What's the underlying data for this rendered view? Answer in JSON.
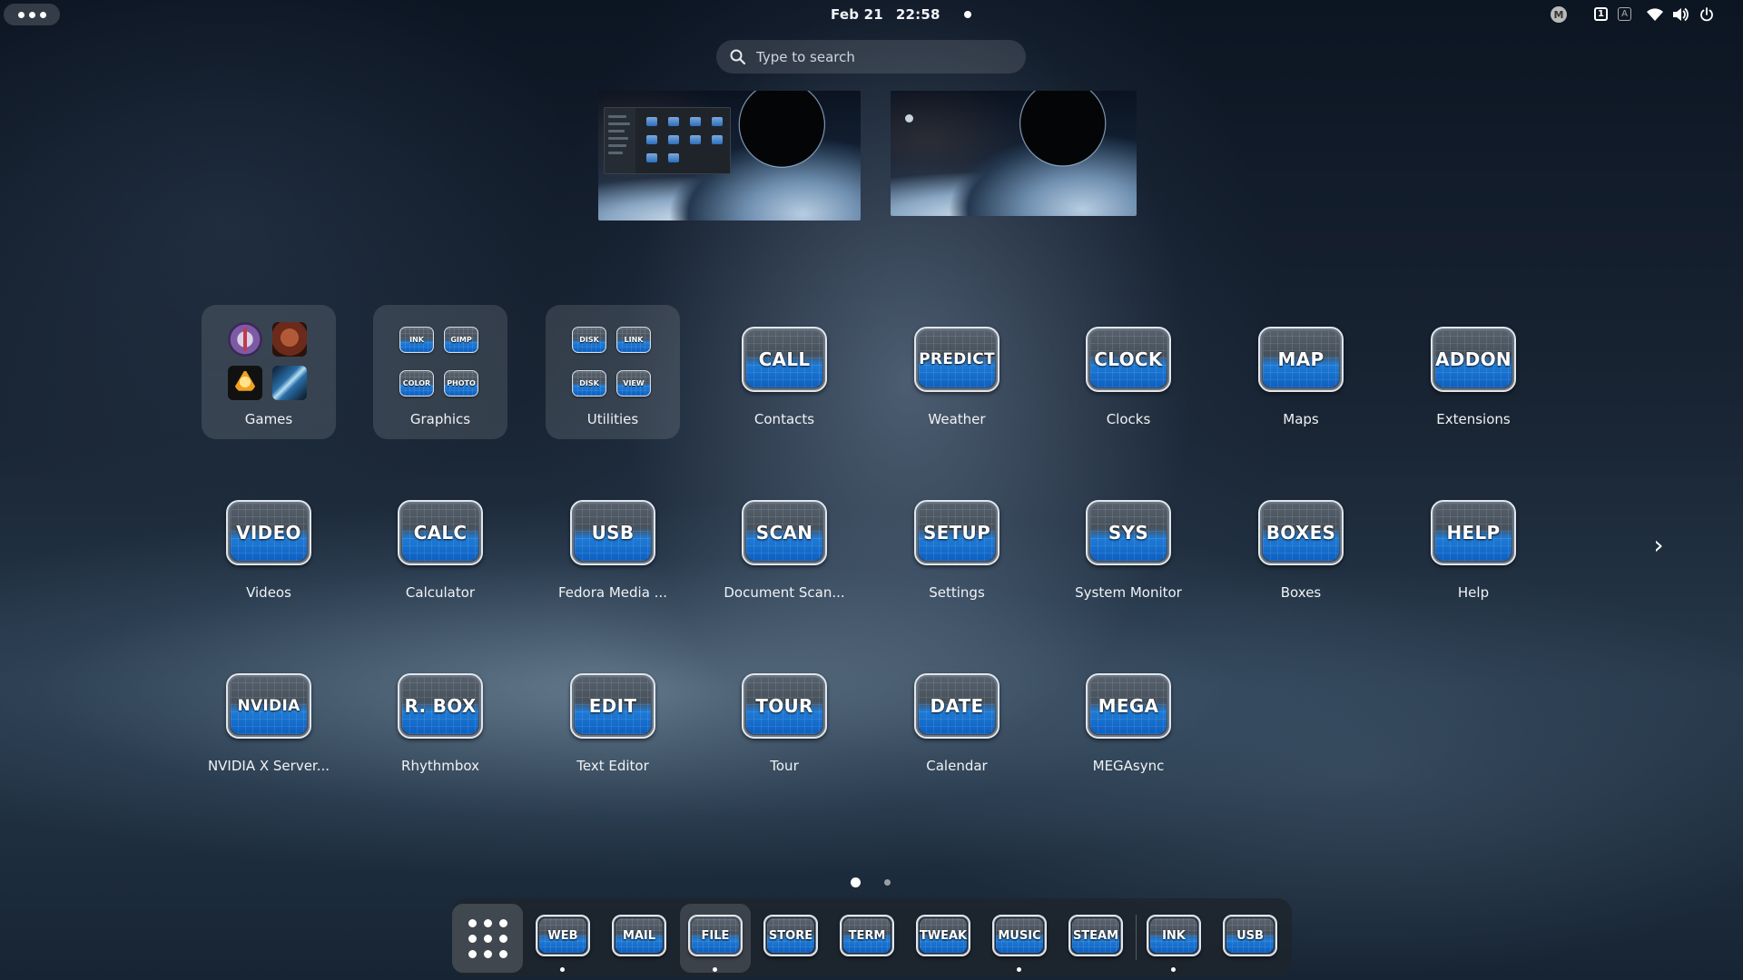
{
  "topbar": {
    "date": "Feb 21",
    "time": "22:58",
    "tray": {
      "mega_label": "M",
      "workspace_1": "1",
      "workspace_2": "A",
      "icons": [
        "mega-icon",
        "workspace-indicator-icon",
        "keyboard-layout-icon",
        "wifi-icon",
        "volume-icon",
        "power-icon"
      ]
    }
  },
  "search": {
    "placeholder": "Type to search"
  },
  "app_grid": {
    "folders": [
      {
        "label": "Games",
        "items": []
      },
      {
        "label": "Graphics",
        "items": [
          "INK",
          "GIMP",
          "COLOR",
          "PHOTO"
        ]
      },
      {
        "label": "Utilities",
        "items": [
          "DISK",
          "LINK",
          "DISK",
          "VIEW"
        ]
      }
    ],
    "apps": [
      {
        "label": "Contacts",
        "icon_text": "CALL"
      },
      {
        "label": "Weather",
        "icon_text": "PREDICT"
      },
      {
        "label": "Clocks",
        "icon_text": "CLOCK"
      },
      {
        "label": "Maps",
        "icon_text": "MAP"
      },
      {
        "label": "Extensions",
        "icon_text": "ADDON"
      },
      {
        "label": "Videos",
        "icon_text": "VIDEO"
      },
      {
        "label": "Calculator",
        "icon_text": "CALC"
      },
      {
        "label": "Fedora Media ...",
        "icon_text": "USB"
      },
      {
        "label": "Document Scan...",
        "icon_text": "SCAN"
      },
      {
        "label": "Settings",
        "icon_text": "SETUP"
      },
      {
        "label": "System Monitor",
        "icon_text": "SYS"
      },
      {
        "label": "Boxes",
        "icon_text": "BOXES"
      },
      {
        "label": "Help",
        "icon_text": "HELP"
      },
      {
        "label": "NVIDIA X Server...",
        "icon_text": "NVIDIA"
      },
      {
        "label": "Rhythmbox",
        "icon_text": "R. BOX"
      },
      {
        "label": "Text Editor",
        "icon_text": "EDIT"
      },
      {
        "label": "Tour",
        "icon_text": "TOUR"
      },
      {
        "label": "Calendar",
        "icon_text": "DATE"
      },
      {
        "label": "MEGAsync",
        "icon_text": "MEGA"
      }
    ],
    "next_page_arrow": "›",
    "current_page": 1,
    "page_count": 2
  },
  "dash": {
    "items": [
      {
        "icon_text": "WEB",
        "running": true,
        "active": false
      },
      {
        "icon_text": "MAIL",
        "running": false,
        "active": false
      },
      {
        "icon_text": "FILE",
        "running": true,
        "active": true
      },
      {
        "icon_text": "STORE",
        "running": false,
        "active": false
      },
      {
        "icon_text": "TERM",
        "running": false,
        "active": false
      },
      {
        "icon_text": "TWEAK",
        "running": false,
        "active": false
      },
      {
        "icon_text": "MUSIC",
        "running": true,
        "active": false
      },
      {
        "icon_text": "STEAM",
        "running": false,
        "active": false
      },
      {
        "icon_text": "INK",
        "running": true,
        "active": false
      },
      {
        "icon_text": "USB",
        "running": false,
        "active": false
      }
    ]
  }
}
